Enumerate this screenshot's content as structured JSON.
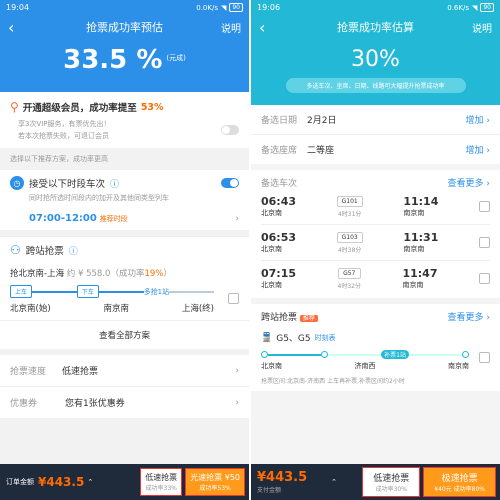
{
  "left": {
    "status": {
      "time": "19:04",
      "net": "0.0K/s",
      "batt": "90"
    },
    "nav": {
      "title": "抢票成功率预估",
      "help": "说明"
    },
    "rate": {
      "value": "33.5 %",
      "note": "(元成)"
    },
    "vip": {
      "title": "开通超级会员，成功率提至",
      "pct": "53%",
      "line1": "享3次VIP服务，有票优先出！",
      "line2": "若本次抢票失败，可退订会员"
    },
    "section_title": "选择以下推荐方案，成功率更高",
    "accept": {
      "title": "接受以下时段车次",
      "desc": "同时抢所选时间段内的加开及其他同类型列车",
      "time": "07:00-12:00",
      "tag": "推荐时段"
    },
    "cross": {
      "title": "跨站抢票",
      "route": "抢北京南-上海",
      "price_label": "约 ¥ 558.0",
      "rate_label": "（成功率",
      "rate_val": "19%",
      "rate_end": "）",
      "tag1": "上车",
      "tag2": "下车",
      "multi": "多抢1站",
      "st1": "北京南(始)",
      "st2": "南京南",
      "st3": "上海(终)"
    },
    "view_all": "查看全部方案",
    "speed": {
      "label": "抢票速度",
      "value": "低速抢票"
    },
    "coupon": {
      "label": "优惠券",
      "value": "您有1张优惠券"
    },
    "bottom": {
      "label": "订单金额",
      "price": "¥443.5",
      "b1_title": "低速抢票",
      "b1_sub": "成功率33%",
      "b2_title": "光速抢票 ¥50",
      "b2_sub": "成功率53%"
    }
  },
  "right": {
    "status": {
      "time": "19:06",
      "net": "0.6K/s",
      "batt": "90"
    },
    "nav": {
      "title": "抢票成功率估算",
      "help": "说明"
    },
    "rate": "30%",
    "pill": "多选车次、坐席、日期、线路可大幅提升抢票成功率",
    "date": {
      "label": "备选日期",
      "value": "2月2日",
      "action": "增加"
    },
    "seat": {
      "label": "备选座席",
      "value": "二等座",
      "action": "增加"
    },
    "trains_label": "备选车次",
    "trains_more": "查看更多",
    "trains": [
      {
        "dep": "06:43",
        "from": "北京南",
        "no": "G101",
        "dur": "4时31分",
        "arr": "11:14",
        "to": "南京南"
      },
      {
        "dep": "06:53",
        "from": "北京南",
        "no": "G103",
        "dur": "4时38分",
        "arr": "11:31",
        "to": "南京南"
      },
      {
        "dep": "07:15",
        "from": "北京南",
        "no": "G57",
        "dur": "4时32分",
        "arr": "11:47",
        "to": "南京南"
      }
    ],
    "cross": {
      "label": "跨站抢票",
      "tag": "推荐",
      "more": "查看更多",
      "trains": "G5、G5",
      "tag2": "时刻表",
      "st1": "北京南",
      "st2": "济南西",
      "st3": "南京南",
      "bu": "补票1站",
      "note": "抢票区间:北京南-济南西 上车再补票,补票区间约2小时"
    },
    "bottom": {
      "price": "¥443.5",
      "sub": "支付金额",
      "b1_title": "低速抢票",
      "b1_sub": "成功率30%",
      "b2_title": "极速抢票",
      "b2_sub": "¥40元 成功率80%"
    }
  }
}
